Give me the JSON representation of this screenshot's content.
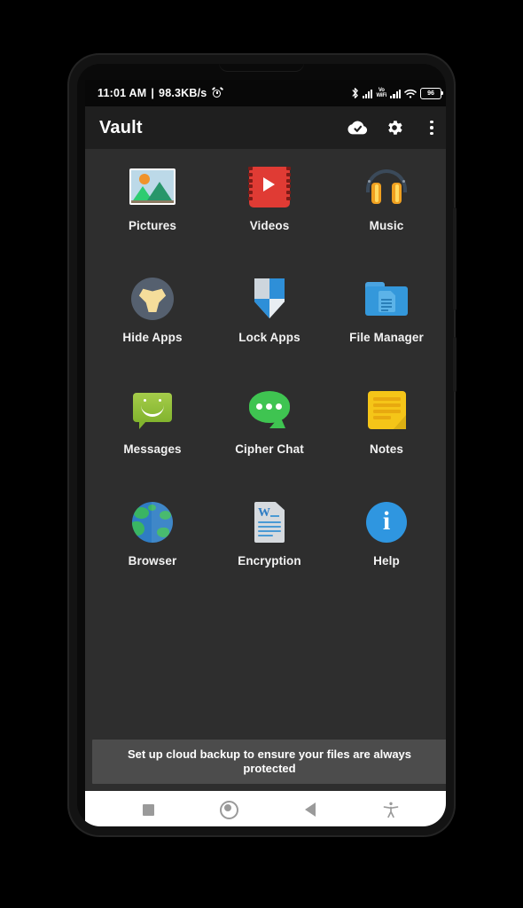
{
  "status_bar": {
    "time": "11:01 AM",
    "separator": "|",
    "network_speed": "98.3KB/s",
    "alarm_icon": "alarm-icon",
    "bluetooth_icon": "bluetooth-icon",
    "signal_icon_1": "cellular-signal-icon",
    "vowifi_top": "Vo",
    "vowifi_bottom": "WiFi",
    "signal_icon_2": "cellular-signal-icon",
    "wifi_icon": "wifi-icon",
    "battery_level": "96"
  },
  "app_bar": {
    "title": "Vault",
    "cloud_backup_icon": "cloud-done-icon",
    "settings_icon": "gear-icon",
    "overflow_icon": "overflow-menu-icon"
  },
  "grid": {
    "items": [
      {
        "label": "Pictures",
        "icon": "pictures-icon"
      },
      {
        "label": "Videos",
        "icon": "videos-icon"
      },
      {
        "label": "Music",
        "icon": "music-icon"
      },
      {
        "label": "Hide Apps",
        "icon": "hide-apps-icon"
      },
      {
        "label": "Lock Apps",
        "icon": "lock-apps-icon"
      },
      {
        "label": "File Manager",
        "icon": "file-manager-icon"
      },
      {
        "label": "Messages",
        "icon": "messages-icon"
      },
      {
        "label": "Cipher Chat",
        "icon": "cipher-chat-icon"
      },
      {
        "label": "Notes",
        "icon": "notes-icon"
      },
      {
        "label": "Browser",
        "icon": "browser-icon"
      },
      {
        "label": "Encryption",
        "icon": "encryption-icon"
      },
      {
        "label": "Help",
        "icon": "help-icon"
      }
    ]
  },
  "toast": {
    "message": "Set up cloud backup to ensure your files are always protected"
  },
  "nav_bar": {
    "recents_icon": "recents-square-icon",
    "home_icon": "home-circle-icon",
    "back_icon": "back-triangle-icon",
    "accessibility_icon": "accessibility-icon"
  },
  "colors": {
    "screen_background": "#2e2e2e",
    "app_bar_background": "#1f1f1f",
    "status_bar_background": "#080808",
    "toast_background": "#4c4c4c",
    "nav_bar_background": "#ffffff",
    "accent_blue": "#2f96e0"
  }
}
